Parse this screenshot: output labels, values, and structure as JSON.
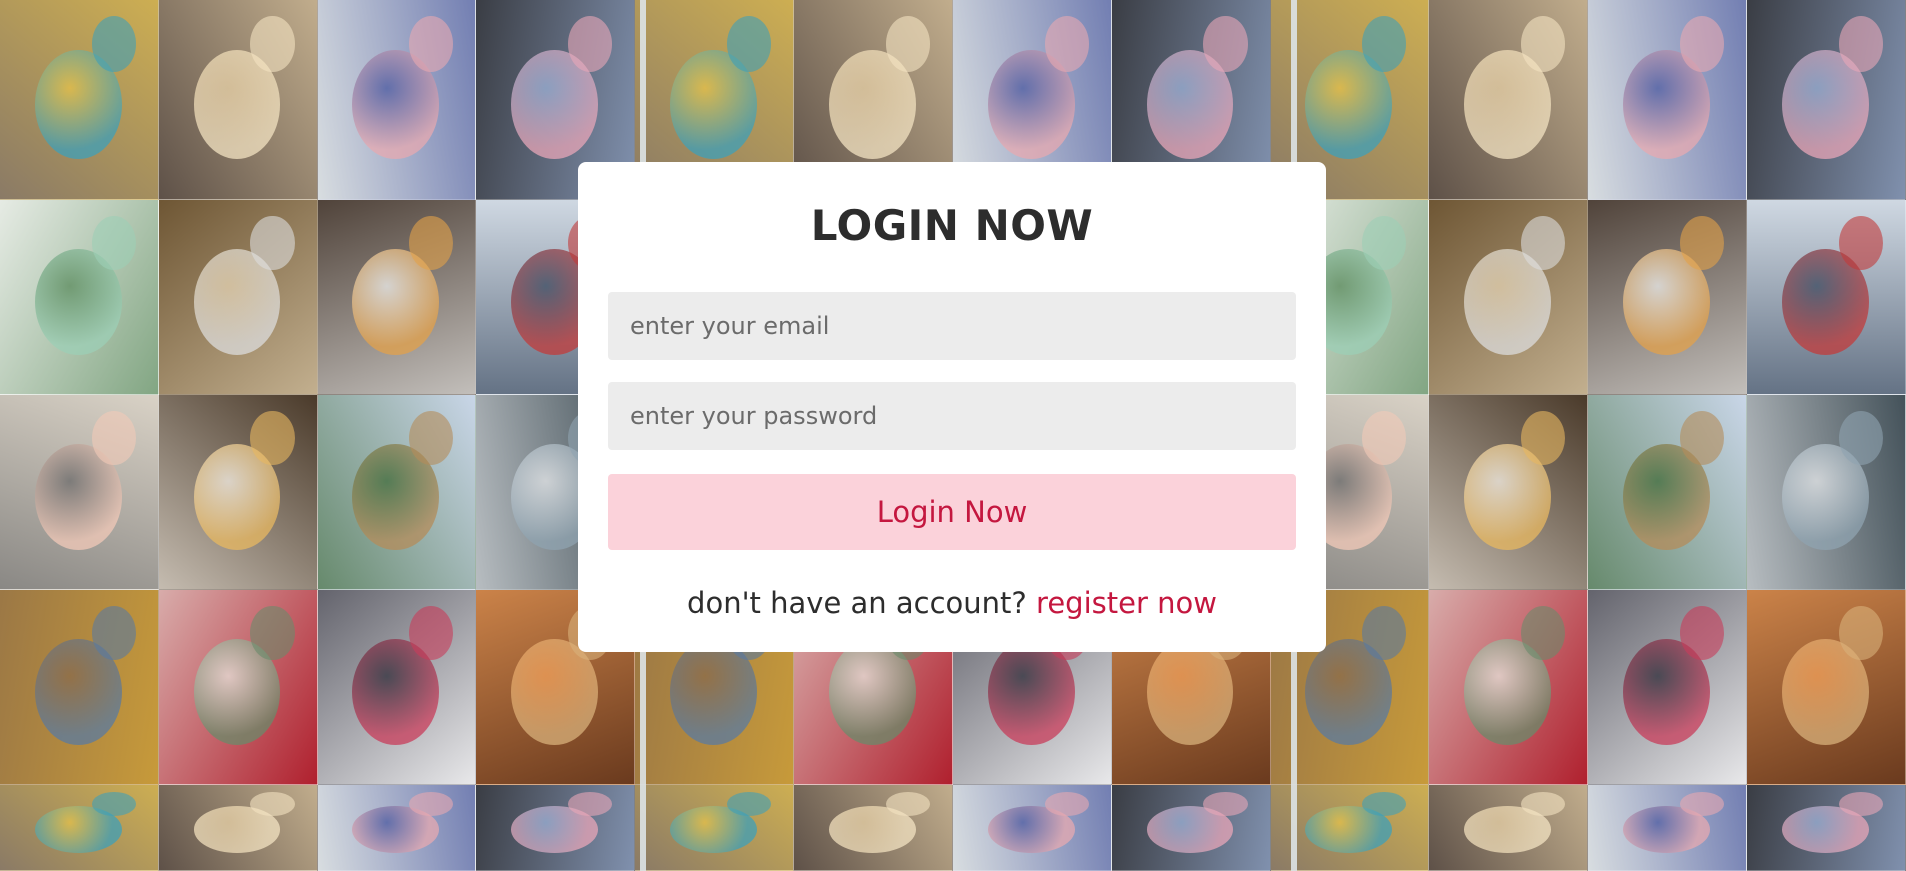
{
  "login": {
    "title": "LOGIN NOW",
    "email_placeholder": "enter your email",
    "password_placeholder": "enter your password",
    "submit_label": "Login Now",
    "register_prompt": "don't have an account?",
    "register_link": "register now"
  },
  "colors": {
    "accent": "#c4173f",
    "button_bg": "#fbd2da",
    "field_bg": "#ececec",
    "title": "#2d2d2d"
  }
}
